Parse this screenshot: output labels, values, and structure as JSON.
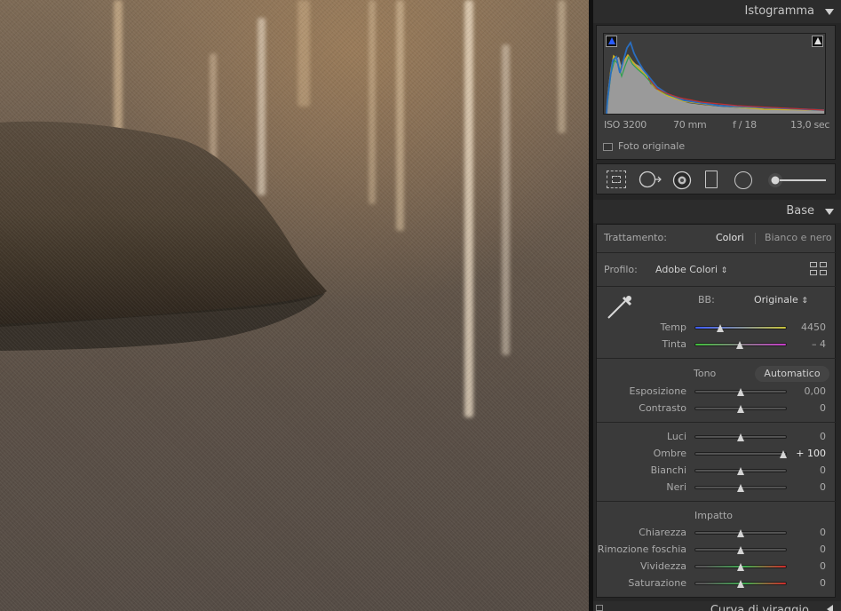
{
  "histogram": {
    "title": "Istogramma",
    "exif": {
      "iso": "ISO 3200",
      "focal": "70 mm",
      "aperture": "f / 18",
      "shutter": "13,0 sec"
    },
    "original_photo_label": "Foto originale"
  },
  "tools": {
    "items": [
      "crop-overlay",
      "spot-removal",
      "red-eye",
      "graduated-filter",
      "radial-filter",
      "adjustment-brush"
    ]
  },
  "base": {
    "title": "Base",
    "treatment_label": "Trattamento:",
    "treatment_color": "Colori",
    "treatment_bw": "Bianco e nero",
    "profile_label": "Profilo:",
    "profile_value": "Adobe Colori",
    "profile_arrows": "⇕",
    "wb_label": "BB:",
    "wb_value": "Originale",
    "wb_arrows": "⇕",
    "temp": {
      "label": "Temp",
      "value": "4450",
      "fraction": 0.28
    },
    "tint": {
      "label": "Tinta",
      "value": "– 4",
      "fraction": 0.49
    },
    "tone_label": "Tono",
    "auto_label": "Automatico",
    "exposure": {
      "label": "Esposizione",
      "value": "0,00",
      "fraction": 0.5
    },
    "contrast": {
      "label": "Contrasto",
      "value": "0",
      "fraction": 0.5
    },
    "highlights": {
      "label": "Luci",
      "value": "0",
      "fraction": 0.5
    },
    "shadows": {
      "label": "Ombre",
      "value": "+ 100",
      "fraction": 0.96
    },
    "whites": {
      "label": "Bianchi",
      "value": "0",
      "fraction": 0.5
    },
    "blacks": {
      "label": "Neri",
      "value": "0",
      "fraction": 0.5
    },
    "presence_label": "Impatto",
    "clarity": {
      "label": "Chiarezza",
      "value": "0",
      "fraction": 0.5
    },
    "dehaze": {
      "label": "Rimozione foschia",
      "value": "0",
      "fraction": 0.5
    },
    "vibrance": {
      "label": "Vividezza",
      "value": "0",
      "fraction": 0.5
    },
    "saturation": {
      "label": "Saturazione",
      "value": "0",
      "fraction": 0.5
    }
  },
  "next_panel": {
    "title": "Curva di viraggio"
  },
  "colors": {
    "panel_bg": "#262626",
    "section_bg": "#3a3a3a",
    "header_bg": "#2c2c2c",
    "text": "#aaaaaa"
  }
}
